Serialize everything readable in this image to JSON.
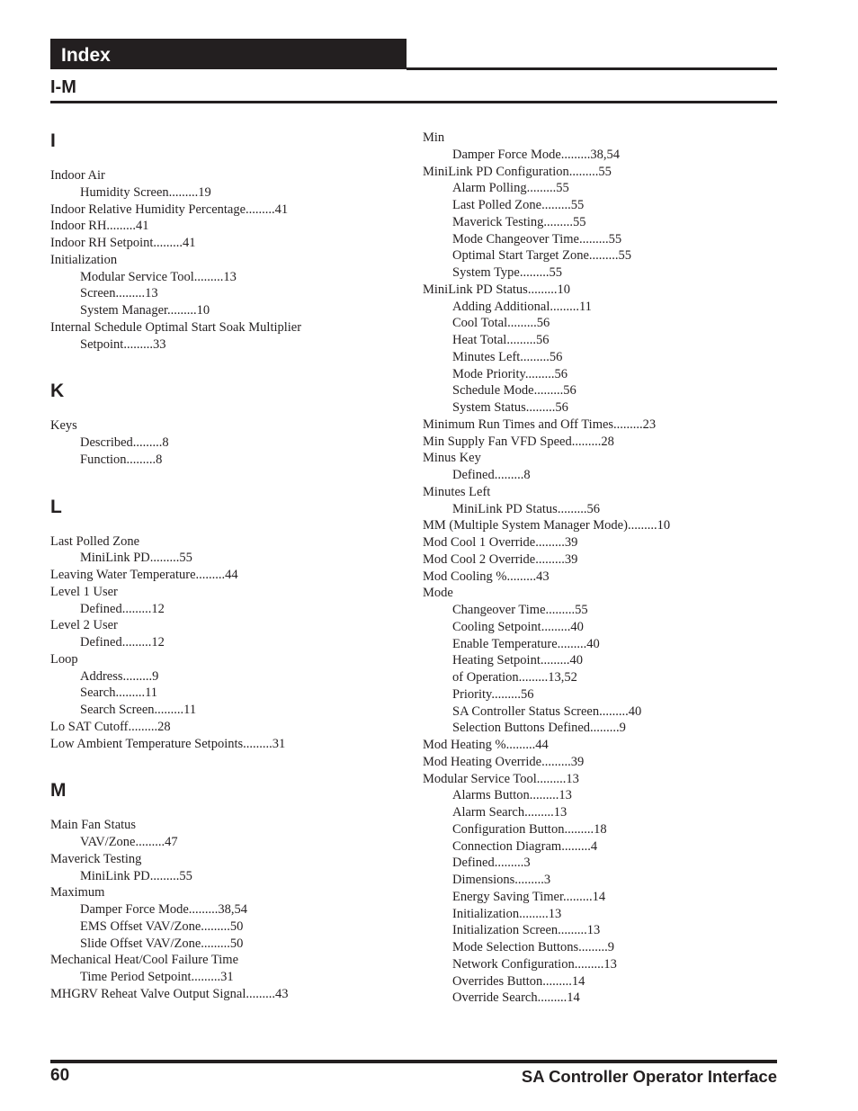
{
  "header": {
    "title": "Index",
    "section": "I-M"
  },
  "left_column": [
    {
      "type": "letter",
      "text": "I"
    },
    {
      "type": "main",
      "text": "Indoor Air"
    },
    {
      "type": "sub",
      "text": "Humidity Screen.........19"
    },
    {
      "type": "main",
      "text": "Indoor Relative Humidity Percentage.........41"
    },
    {
      "type": "main",
      "text": "Indoor RH.........41"
    },
    {
      "type": "main",
      "text": "Indoor RH Setpoint.........41"
    },
    {
      "type": "main",
      "text": "Initialization"
    },
    {
      "type": "sub",
      "text": "Modular Service Tool.........13"
    },
    {
      "type": "sub",
      "text": "Screen.........13"
    },
    {
      "type": "sub",
      "text": "System Manager.........10"
    },
    {
      "type": "main",
      "text": "Internal Schedule Optimal Start Soak Multiplier"
    },
    {
      "type": "sub",
      "text": "Setpoint.........33"
    },
    {
      "type": "letter",
      "text": "K"
    },
    {
      "type": "main",
      "text": "Keys"
    },
    {
      "type": "sub",
      "text": "Described.........8"
    },
    {
      "type": "sub",
      "text": "Function.........8"
    },
    {
      "type": "letter",
      "text": "L"
    },
    {
      "type": "main",
      "text": "Last Polled Zone"
    },
    {
      "type": "sub",
      "text": "MiniLink PD.........55"
    },
    {
      "type": "main",
      "text": "Leaving Water Temperature.........44"
    },
    {
      "type": "main",
      "text": "Level 1 User"
    },
    {
      "type": "sub",
      "text": "Defined.........12"
    },
    {
      "type": "main",
      "text": "Level 2 User"
    },
    {
      "type": "sub",
      "text": "Defined.........12"
    },
    {
      "type": "main",
      "text": "Loop"
    },
    {
      "type": "sub",
      "text": "Address.........9"
    },
    {
      "type": "sub",
      "text": "Search.........11"
    },
    {
      "type": "sub",
      "text": "Search Screen.........11"
    },
    {
      "type": "main",
      "text": "Lo SAT Cutoff.........28"
    },
    {
      "type": "main",
      "text": "Low Ambient Temperature Setpoints.........31"
    },
    {
      "type": "letter",
      "text": "M"
    },
    {
      "type": "main",
      "text": "Main Fan Status"
    },
    {
      "type": "sub",
      "text": "VAV/Zone.........47"
    },
    {
      "type": "main",
      "text": "Maverick Testing"
    },
    {
      "type": "sub",
      "text": "MiniLink PD.........55"
    },
    {
      "type": "main",
      "text": "Maximum"
    },
    {
      "type": "sub",
      "text": "Damper Force Mode.........38,54"
    },
    {
      "type": "sub",
      "text": "EMS Offset VAV/Zone.........50"
    },
    {
      "type": "sub",
      "text": "Slide Offset VAV/Zone.........50"
    },
    {
      "type": "main",
      "text": "Mechanical Heat/Cool Failure Time"
    },
    {
      "type": "sub",
      "text": "Time Period Setpoint.........31"
    },
    {
      "type": "main",
      "text": "MHGRV Reheat Valve Output Signal.........43"
    }
  ],
  "right_column": [
    {
      "type": "main",
      "text": "Min"
    },
    {
      "type": "sub",
      "text": "Damper Force Mode.........38,54"
    },
    {
      "type": "main",
      "text": "MiniLink PD Configuration.........55"
    },
    {
      "type": "sub",
      "text": "Alarm Polling.........55"
    },
    {
      "type": "sub",
      "text": "Last Polled Zone.........55"
    },
    {
      "type": "sub",
      "text": "Maverick Testing.........55"
    },
    {
      "type": "sub",
      "text": "Mode Changeover Time.........55"
    },
    {
      "type": "sub",
      "text": "Optimal Start Target Zone.........55"
    },
    {
      "type": "sub",
      "text": "System Type.........55"
    },
    {
      "type": "main",
      "text": "MiniLink PD Status.........10"
    },
    {
      "type": "sub",
      "text": "Adding Additional.........11"
    },
    {
      "type": "sub",
      "text": "Cool Total.........56"
    },
    {
      "type": "sub",
      "text": "Heat Total.........56"
    },
    {
      "type": "sub",
      "text": "Minutes Left.........56"
    },
    {
      "type": "sub",
      "text": "Mode Priority.........56"
    },
    {
      "type": "sub",
      "text": "Schedule Mode.........56"
    },
    {
      "type": "sub",
      "text": "System Status.........56"
    },
    {
      "type": "main",
      "text": "Minimum Run Times and Off Times.........23"
    },
    {
      "type": "main",
      "text": "Min Supply Fan VFD Speed.........28"
    },
    {
      "type": "main",
      "text": "Minus Key"
    },
    {
      "type": "sub",
      "text": "Defined.........8"
    },
    {
      "type": "main",
      "text": "Minutes Left"
    },
    {
      "type": "sub",
      "text": "MiniLink PD Status.........56"
    },
    {
      "type": "main",
      "text": "MM (Multiple System Manager Mode).........10"
    },
    {
      "type": "main",
      "text": "Mod Cool 1 Override.........39"
    },
    {
      "type": "main",
      "text": "Mod Cool 2 Override.........39"
    },
    {
      "type": "main",
      "text": "Mod Cooling %.........43"
    },
    {
      "type": "main",
      "text": "Mode"
    },
    {
      "type": "sub",
      "text": "Changeover Time.........55"
    },
    {
      "type": "sub",
      "text": "Cooling Setpoint.........40"
    },
    {
      "type": "sub",
      "text": "Enable Temperature.........40"
    },
    {
      "type": "sub",
      "text": "Heating Setpoint.........40"
    },
    {
      "type": "sub",
      "text": "of Operation.........13,52"
    },
    {
      "type": "sub",
      "text": "Priority.........56"
    },
    {
      "type": "sub",
      "text": "SA Controller Status Screen.........40"
    },
    {
      "type": "sub",
      "text": "Selection Buttons Defined.........9"
    },
    {
      "type": "main",
      "text": "Mod Heating %.........44"
    },
    {
      "type": "main",
      "text": "Mod Heating Override.........39"
    },
    {
      "type": "main",
      "text": "Modular Service Tool.........13"
    },
    {
      "type": "sub",
      "text": "Alarms Button.........13"
    },
    {
      "type": "sub",
      "text": "Alarm Search.........13"
    },
    {
      "type": "sub",
      "text": "Configuration Button.........18"
    },
    {
      "type": "sub",
      "text": "Connection Diagram.........4"
    },
    {
      "type": "sub",
      "text": "Defined.........3"
    },
    {
      "type": "sub",
      "text": "Dimensions.........3"
    },
    {
      "type": "sub",
      "text": "Energy Saving Timer.........14"
    },
    {
      "type": "sub",
      "text": "Initialization.........13"
    },
    {
      "type": "sub",
      "text": "Initialization Screen.........13"
    },
    {
      "type": "sub",
      "text": "Mode Selection Buttons.........9"
    },
    {
      "type": "sub",
      "text": "Network Configuration.........13"
    },
    {
      "type": "sub",
      "text": "Overrides Button.........14"
    },
    {
      "type": "sub",
      "text": "Override Search.........14"
    }
  ],
  "footer": {
    "page_number": "60",
    "document_title": "SA Controller Operator Interface"
  }
}
